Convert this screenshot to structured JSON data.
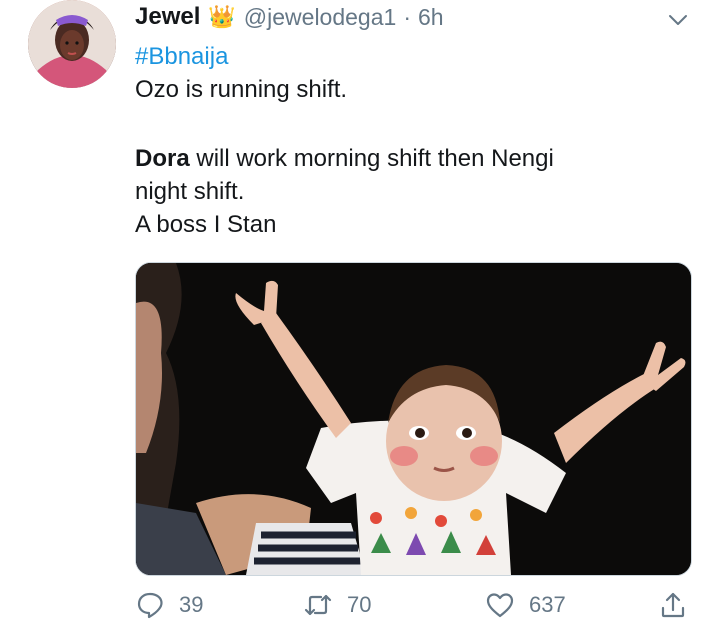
{
  "tweet": {
    "author_name": "Jewel",
    "author_badge": "crown-emoji",
    "handle": "@jewelodega1",
    "separator": "·",
    "time": "6h",
    "hashtag": "#Bbnaija",
    "line1": "Ozo is running shift.",
    "line2_bold": "Dora",
    "line2_rest": " will work morning shift then Nengi",
    "line3": "night shift.",
    "line4": "A boss I Stan"
  },
  "actions": {
    "replies": "39",
    "retweets": "70",
    "likes": "637"
  },
  "colors": {
    "hashtag": "#1b95e0",
    "secondary_text": "#657786",
    "border": "#ccd6dd"
  }
}
